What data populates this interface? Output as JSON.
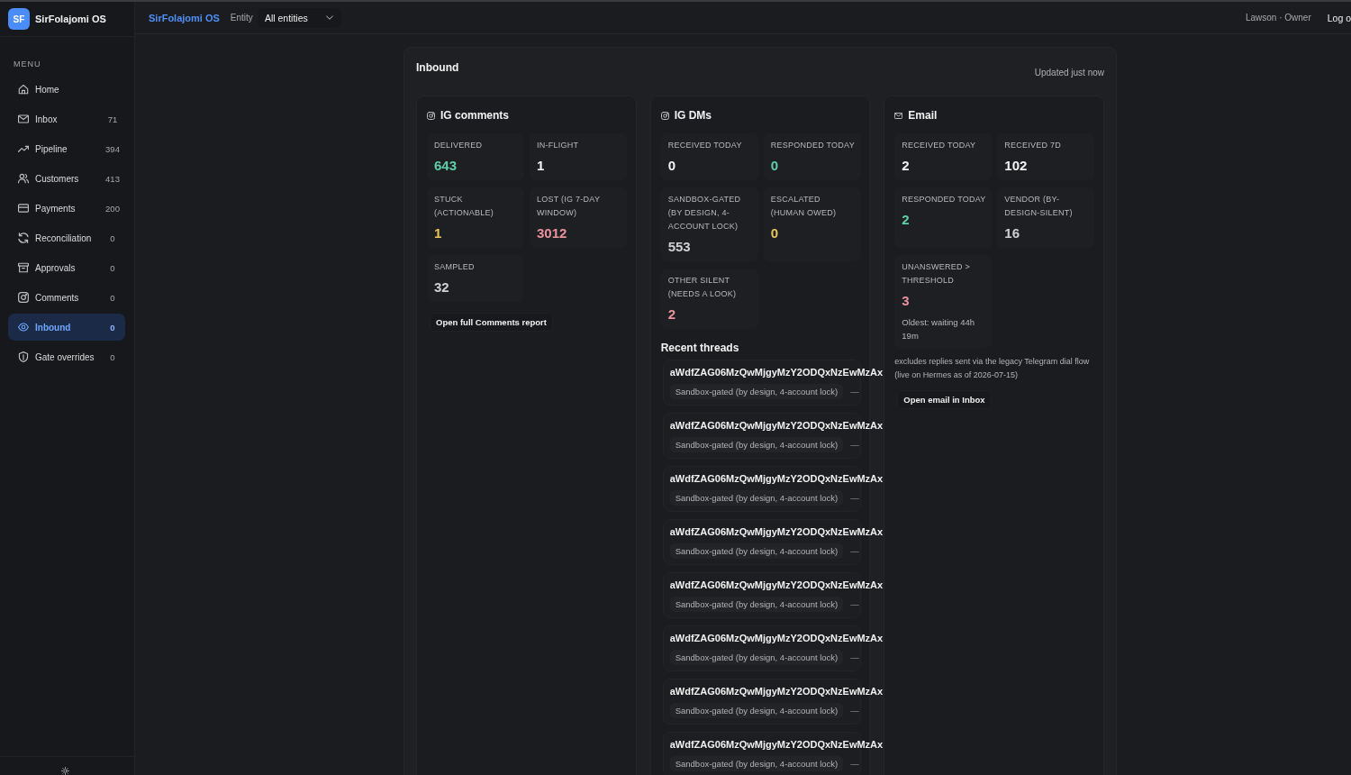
{
  "sidebar": {
    "logo": "SF",
    "brand": "SirFolajomi OS",
    "menu_heading": "MENU",
    "items": [
      {
        "label": "Home",
        "selected": false
      },
      {
        "label": "Inbox",
        "count": "71",
        "selected": false
      },
      {
        "label": "Pipeline",
        "count": "394",
        "selected": false
      },
      {
        "label": "Customers",
        "count": "413",
        "selected": false
      },
      {
        "label": "Payments",
        "count": "200",
        "selected": false
      },
      {
        "label": "Reconciliation",
        "count": "0",
        "selected": false
      },
      {
        "label": "Approvals",
        "count": "0",
        "selected": false
      },
      {
        "label": "Comments",
        "count": "0",
        "selected": false
      },
      {
        "label": "Inbound",
        "count": "0",
        "selected": true
      },
      {
        "label": "Gate overrides",
        "count": "0",
        "selected": false
      }
    ]
  },
  "topbar": {
    "brand": "SirFolajomi OS",
    "entity_label": "Entity",
    "entity_select": {
      "value": "All entities"
    },
    "user": "Lawson · Owner",
    "logout": "Log o"
  },
  "panel": {
    "title": "Inbound",
    "updated": "Updated just now",
    "cards": [
      {
        "title": "IG comments",
        "metrics": [
          {
            "label": "DELIVERED",
            "value": "643",
            "color": "#5fcfa8"
          },
          {
            "label": "IN-FLIGHT",
            "value": "1",
            "color": "#f2f2f2"
          },
          {
            "label": "STUCK (ACTIONABLE)",
            "value": "1",
            "color": "#e8c55c"
          },
          {
            "label": "LOST (IG 7-DAY WINDOW)",
            "value": "3012",
            "color": "#e8939c"
          },
          {
            "label": "SAMPLED",
            "value": "32",
            "color": "#d0d0d3"
          }
        ],
        "action": "Open full Comments report"
      },
      {
        "title": "IG DMs",
        "metrics": [
          {
            "label": "RECEIVED TODAY",
            "value": "0",
            "color": "#f2f2f2"
          },
          {
            "label": "RESPONDED TODAY",
            "value": "0",
            "color": "#5fcfa8"
          },
          {
            "label": "SANDBOX-GATED (BY DESIGN, 4-ACCOUNT LOCK)",
            "value": "553",
            "color": "#d0d0d3"
          },
          {
            "label": "ESCALATED (HUMAN OWED)",
            "value": "0",
            "color": "#e8c55c"
          },
          {
            "label": "OTHER SILENT (NEEDS A LOOK)",
            "value": "2",
            "color": "#e8939c"
          }
        ],
        "recent_threads": {
          "heading": "Recent threads",
          "items": [
            {
              "title": "aWdfZAG06MzQwMjgyMzY2ODQxNzEwMzAx",
              "status": "Sandbox-gated (by design, 4-account lock)",
              "detail": "—"
            },
            {
              "title": "aWdfZAG06MzQwMjgyMzY2ODQxNzEwMzAx",
              "status": "Sandbox-gated (by design, 4-account lock)",
              "detail": "—"
            },
            {
              "title": "aWdfZAG06MzQwMjgyMzY2ODQxNzEwMzAx",
              "status": "Sandbox-gated (by design, 4-account lock)",
              "detail": "—"
            },
            {
              "title": "aWdfZAG06MzQwMjgyMzY2ODQxNzEwMzAx",
              "status": "Sandbox-gated (by design, 4-account lock)",
              "detail": "—"
            },
            {
              "title": "aWdfZAG06MzQwMjgyMzY2ODQxNzEwMzAx",
              "status": "Sandbox-gated (by design, 4-account lock)",
              "detail": "—"
            },
            {
              "title": "aWdfZAG06MzQwMjgyMzY2ODQxNzEwMzAx",
              "status": "Sandbox-gated (by design, 4-account lock)",
              "detail": "—"
            },
            {
              "title": "aWdfZAG06MzQwMjgyMzY2ODQxNzEwMzAx",
              "status": "Sandbox-gated (by design, 4-account lock)",
              "detail": "—"
            },
            {
              "title": "aWdfZAG06MzQwMjgyMzY2ODQxNzEwMzAx",
              "status": "Sandbox-gated (by design, 4-account lock)",
              "detail": "—"
            }
          ]
        }
      },
      {
        "title": "Email",
        "metrics": [
          {
            "label": "RECEIVED TODAY",
            "value": "2",
            "color": "#f2f2f2"
          },
          {
            "label": "RECEIVED 7D",
            "value": "102",
            "color": "#f2f2f2"
          },
          {
            "label": "RESPONDED TODAY",
            "value": "2",
            "color": "#5fcfa8"
          },
          {
            "label": "VENDOR (BY-DESIGN-SILENT)",
            "value": "16",
            "color": "#d0d0d3"
          },
          {
            "label": "UNANSWERED > THRESHOLD",
            "value": "3",
            "color": "#e8939c",
            "note": "Oldest: waiting 44h 19m"
          }
        ],
        "footnote": "excludes replies sent via the legacy Telegram dial flow (live on Hermes as of 2026-07-15)",
        "action": "Open email in Inbox"
      }
    ]
  }
}
